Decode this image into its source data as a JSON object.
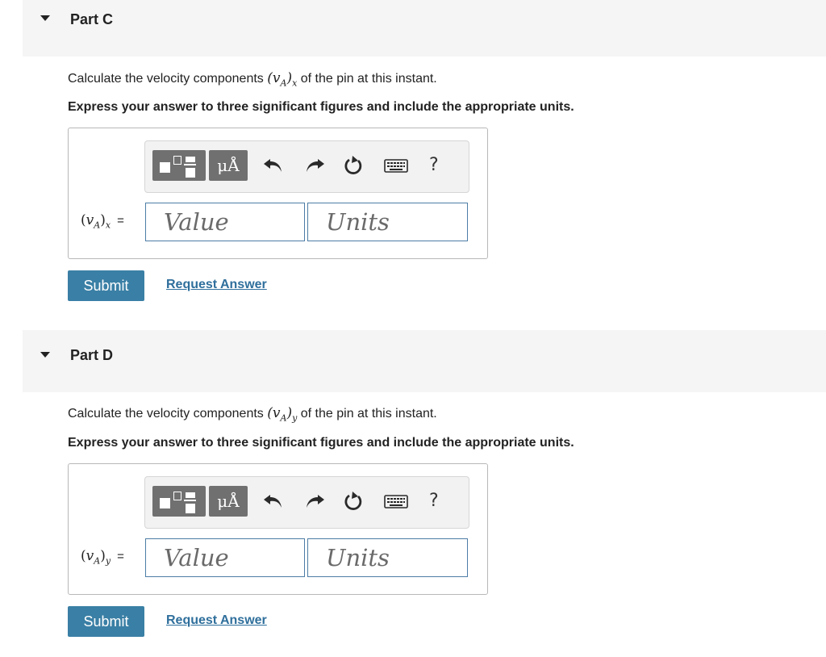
{
  "parts": [
    {
      "title": "Part C",
      "question_prefix": "Calculate the velocity components ",
      "question_var": "v",
      "question_sub_a": "A",
      "question_sub_b": "x",
      "question_suffix": " of the pin at this instant.",
      "instruction": "Express your answer to three significant figures and include the appropriate units.",
      "toolbar": {
        "units_label": "μÅ",
        "help_label": "?"
      },
      "answer_var": "v",
      "answer_sub_a": "A",
      "answer_sub_b": "x",
      "equals": "=",
      "value_placeholder": "Value",
      "units_placeholder": "Units",
      "submit_label": "Submit",
      "request_label": "Request Answer"
    },
    {
      "title": "Part D",
      "question_prefix": "Calculate the velocity components ",
      "question_var": "v",
      "question_sub_a": "A",
      "question_sub_b": "y",
      "question_suffix": " of the pin at this instant.",
      "instruction": "Express your answer to three significant figures and include the appropriate units.",
      "toolbar": {
        "units_label": "μÅ",
        "help_label": "?"
      },
      "answer_var": "v",
      "answer_sub_a": "A",
      "answer_sub_b": "y",
      "equals": "=",
      "value_placeholder": "Value",
      "units_placeholder": "Units",
      "submit_label": "Submit",
      "request_label": "Request Answer"
    }
  ],
  "icons": {
    "caret": "caret-down-icon",
    "templates": "templates-icon",
    "units": "units-icon",
    "undo": "undo-icon",
    "redo": "redo-icon",
    "reset": "reset-icon",
    "keyboard": "keyboard-icon",
    "help": "help-icon"
  },
  "colors": {
    "submit_bg": "#3a7fa5",
    "link": "#2f6f9c",
    "input_border": "#4d7da6",
    "header_bg": "#f5f5f5"
  }
}
